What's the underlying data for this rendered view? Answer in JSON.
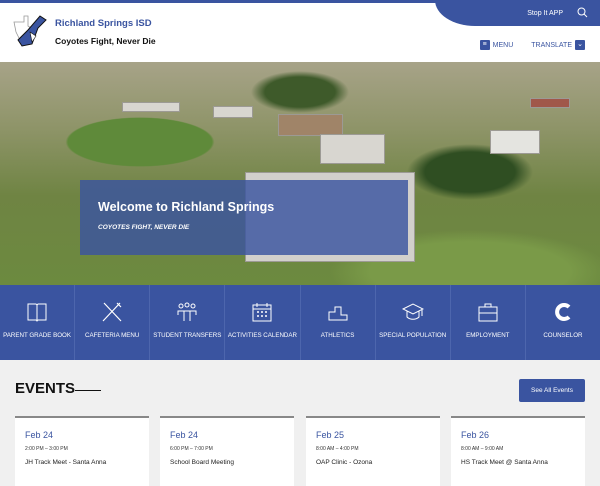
{
  "header": {
    "title": "Richland Springs ISD",
    "motto": "Coyotes Fight, Never Die",
    "stop_it": "Stop It APP",
    "menu": "MENU",
    "translate": "TRANSLATE"
  },
  "hero": {
    "heading": "Welcome to Richland Springs",
    "subheading": "COYOTES FIGHT, NEVER DIE"
  },
  "quicklinks": [
    {
      "label": "PARENT GRADE BOOK",
      "icon": "book-icon"
    },
    {
      "label": "CAFETERIA MENU",
      "icon": "utensils-icon"
    },
    {
      "label": "STUDENT TRANSFERS",
      "icon": "people-icon"
    },
    {
      "label": "ACTIVITIES CALENDAR",
      "icon": "calendar-icon"
    },
    {
      "label": "ATHLETICS",
      "icon": "podium-icon"
    },
    {
      "label": "SPECIAL POPULATION",
      "icon": "graduation-cap-icon"
    },
    {
      "label": "EMPLOYMENT",
      "icon": "briefcase-icon"
    },
    {
      "label": "COUNSELOR",
      "icon": "letter-c-icon"
    }
  ],
  "events": {
    "heading": "EVENTS",
    "see_all": "See All Events",
    "items": [
      {
        "date": "Feb 24",
        "time": "2:00 PM – 3:00 PM",
        "name": "JH Track Meet - Santa Anna"
      },
      {
        "date": "Feb 24",
        "time": "6:00 PM – 7:00 PM",
        "name": "School Board Meeting"
      },
      {
        "date": "Feb 25",
        "time": "8:00 AM – 4:00 PM",
        "name": "OAP Clinic - Ozona"
      },
      {
        "date": "Feb 26",
        "time": "8:00 AM – 9:00 AM",
        "name": "HS Track Meet @ Santa Anna"
      }
    ]
  },
  "colors": {
    "brand": "#3a54a0",
    "background": "#f0f0f0"
  }
}
